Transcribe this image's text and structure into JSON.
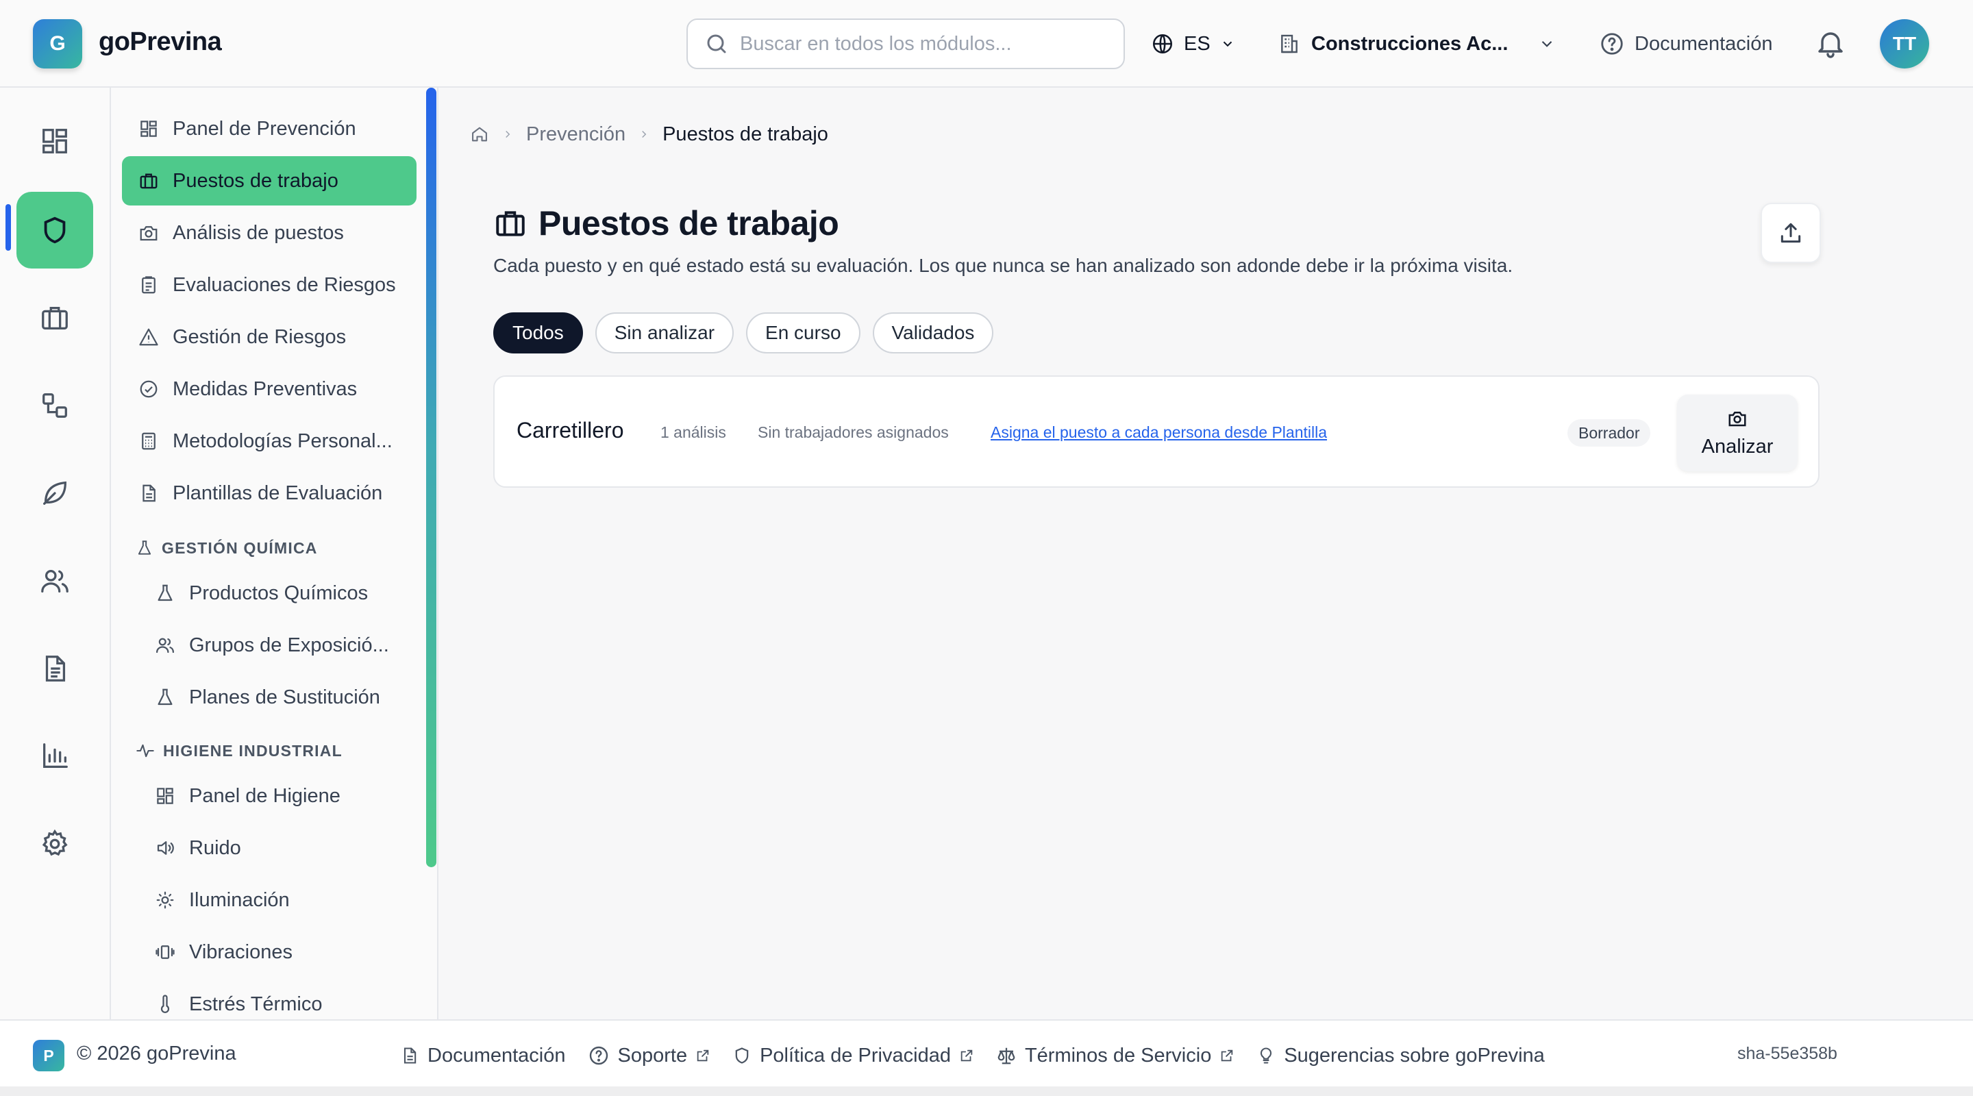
{
  "app": {
    "logo_letter": "G",
    "name": "goPrevina"
  },
  "header": {
    "search_placeholder": "Buscar en todos los módulos...",
    "language": "ES",
    "company": "Construcciones Ac...",
    "docs_label": "Documentación",
    "avatar_initials": "TT"
  },
  "rail": {
    "items": [
      "dashboard-icon",
      "shield-icon",
      "briefcase-icon",
      "workflow-icon",
      "leaf-icon",
      "users-icon",
      "document-icon",
      "bar-chart-icon",
      "gear-icon"
    ],
    "active": "shield-icon"
  },
  "sidebar": {
    "items": [
      {
        "label": "Panel de Prevención",
        "icon": "dashboard-icon"
      },
      {
        "label": "Puestos de trabajo",
        "icon": "briefcase-icon",
        "active": true
      },
      {
        "label": "Análisis de puestos",
        "icon": "camera-icon"
      },
      {
        "label": "Evaluaciones de Riesgos",
        "icon": "clipboard-icon"
      },
      {
        "label": "Gestión de Riesgos",
        "icon": "warning-icon"
      },
      {
        "label": "Medidas Preventivas",
        "icon": "check-circle-icon"
      },
      {
        "label": "Metodologías Personal...",
        "icon": "calculator-icon"
      },
      {
        "label": "Plantillas de Evaluación",
        "icon": "file-icon"
      }
    ],
    "chem_section": {
      "title": "GESTIÓN QUÍMICA",
      "items": [
        {
          "label": "Productos Químicos",
          "icon": "flask-icon"
        },
        {
          "label": "Grupos de Exposició...",
          "icon": "users-icon"
        },
        {
          "label": "Planes de Sustitución",
          "icon": "flask-icon"
        }
      ]
    },
    "hygiene_section": {
      "title": "HIGIENE INDUSTRIAL",
      "items": [
        {
          "label": "Panel de Higiene",
          "icon": "dashboard-icon"
        },
        {
          "label": "Ruido",
          "icon": "speaker-icon"
        },
        {
          "label": "Iluminación",
          "icon": "sun-icon"
        },
        {
          "label": "Vibraciones",
          "icon": "vibration-icon"
        },
        {
          "label": "Estrés Térmico",
          "icon": "thermometer-icon"
        }
      ]
    }
  },
  "breadcrumb": {
    "parent": "Prevención",
    "current": "Puestos de trabajo"
  },
  "page": {
    "title": "Puestos de trabajo",
    "subtitle": "Cada puesto y en qué estado está su evaluación. Los que nunca se han analizado son adonde debe ir la próxima visita.",
    "filters": [
      "Todos",
      "Sin analizar",
      "En curso",
      "Validados"
    ],
    "active_filter": "Todos"
  },
  "jobs": [
    {
      "name": "Carretillero",
      "analyses": "1 análisis",
      "workers": "Sin trabajadores asignados",
      "assign_link": "Asigna el puesto a cada persona desde Plantilla",
      "status": "Borrador",
      "action": "Analizar"
    }
  ],
  "footer": {
    "badge": "P",
    "copyright": "© 2026 goPrevina",
    "links": [
      "Documentación",
      "Soporte",
      "Política de Privacidad",
      "Términos de Servicio",
      "Sugerencias sobre goPrevina"
    ],
    "version": "sha-55e358b"
  },
  "colors": {
    "accent_green": "#4ec98b",
    "brand_blue": "#2563eb",
    "dark_chip": "#0f172a"
  }
}
